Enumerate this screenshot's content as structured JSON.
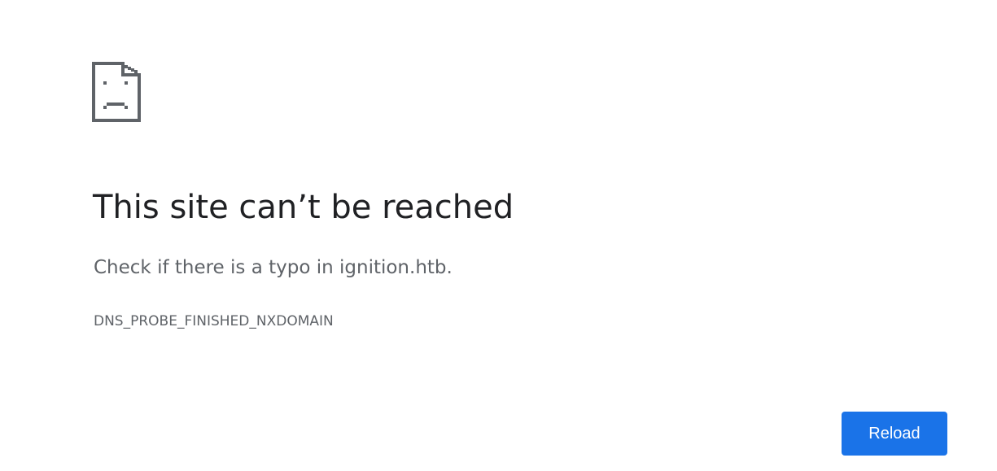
{
  "error": {
    "icon": "sad-page-icon",
    "title": "This site can’t be reached",
    "message": "Check if there is a typo in ignition.htb.",
    "code": "DNS_PROBE_FINISHED_NXDOMAIN"
  },
  "actions": {
    "reload_label": "Reload"
  },
  "colors": {
    "title": "#202124",
    "text": "#5f6368",
    "button": "#1a73e8",
    "button_text": "#ffffff"
  }
}
